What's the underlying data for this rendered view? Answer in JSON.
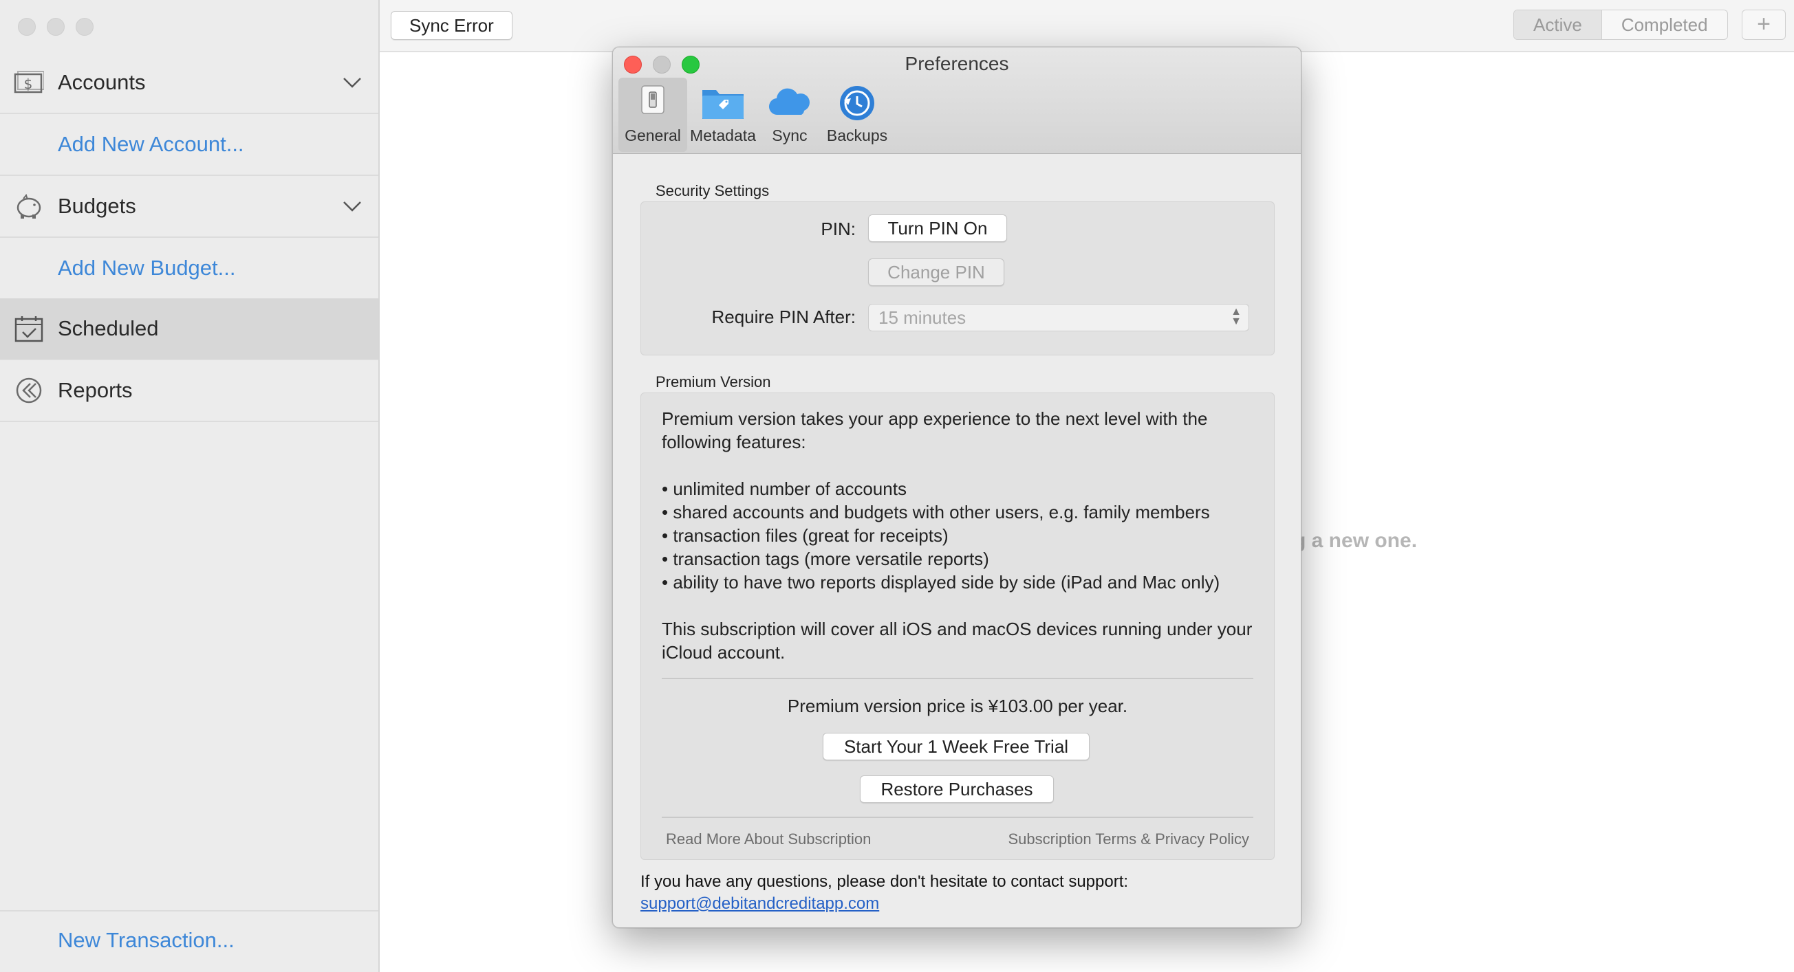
{
  "sidebar": {
    "accounts_label": "Accounts",
    "add_account_label": "Add New Account...",
    "budgets_label": "Budgets",
    "add_budget_label": "Add New Budget...",
    "scheduled_label": "Scheduled",
    "reports_label": "Reports",
    "new_transaction_label": "New Transaction..."
  },
  "toolbar": {
    "sync_error_label": "Sync Error",
    "segments": [
      "Active",
      "Completed"
    ],
    "selected_segment": "Active",
    "add_label": "+"
  },
  "main": {
    "empty_hint": "g a new one."
  },
  "preferences": {
    "title": "Preferences",
    "tabs": [
      "General",
      "Metadata",
      "Sync",
      "Backups"
    ],
    "selected_tab": "General",
    "security": {
      "group_title": "Security Settings",
      "pin_label": "PIN:",
      "turn_pin_on": "Turn PIN On",
      "change_pin": "Change PIN",
      "require_label": "Require PIN After:",
      "require_value": "15 minutes"
    },
    "premium": {
      "group_title": "Premium Version",
      "intro": "Premium version takes your app experience to the next level with the following features:",
      "features": [
        "• unlimited number of accounts",
        "• shared accounts and budgets with other users, e.g. family members",
        "• transaction files (great for receipts)",
        "• transaction tags (more versatile reports)",
        "• ability to have two reports displayed side by side (iPad and Mac only)"
      ],
      "coverage": "This subscription will cover all iOS and macOS devices running under your iCloud account.",
      "price": "Premium version price is ¥103.00 per year.",
      "trial_button": "Start Your 1 Week Free Trial",
      "restore_button": "Restore Purchases",
      "read_more": "Read More About Subscription",
      "terms": "Subscription Terms & Privacy Policy"
    },
    "contact_text": "If you have any questions, please don't hesitate to contact support:",
    "contact_email": "support@debitandcreditapp.com"
  },
  "colors": {
    "link_blue": "#3d87d8",
    "close_red": "#fe5f57",
    "zoom_green": "#28c840"
  }
}
